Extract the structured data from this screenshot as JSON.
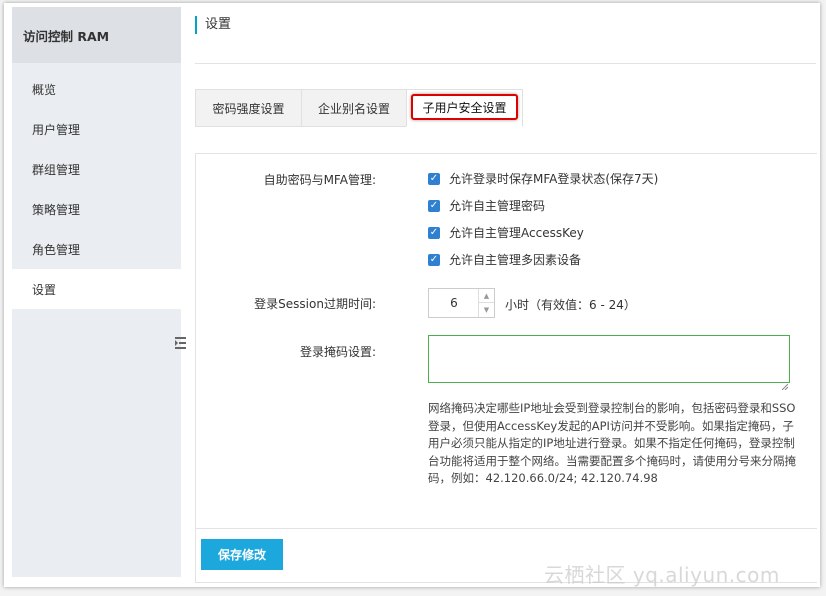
{
  "sidebar": {
    "title": "访问控制 RAM",
    "items": [
      {
        "label": "概览"
      },
      {
        "label": "用户管理"
      },
      {
        "label": "群组管理"
      },
      {
        "label": "策略管理"
      },
      {
        "label": "角色管理"
      },
      {
        "label": "设置",
        "active": true
      }
    ]
  },
  "header": {
    "title": "设置"
  },
  "tabs": [
    {
      "label": "密码强度设置"
    },
    {
      "label": "企业别名设置"
    },
    {
      "label": "子用户安全设置",
      "active": true
    }
  ],
  "form": {
    "mfa_label": "自助密码与MFA管理:",
    "options": [
      {
        "label": "允许登录时保存MFA登录状态(保存7天)",
        "checked": true
      },
      {
        "label": "允许自主管理密码",
        "checked": true
      },
      {
        "label": "允许自主管理AccessKey",
        "checked": true
      },
      {
        "label": "允许自主管理多因素设备",
        "checked": true
      }
    ],
    "session_label": "登录Session过期时间:",
    "session_value": "6",
    "session_unit": "小时（有效值：6 - 24）",
    "mask_label": "登录掩码设置:",
    "mask_value": "",
    "mask_help": "网络掩码决定哪些IP地址会受到登录控制台的影响，包括密码登录和SSO登录，但使用AccessKey发起的API访问并不受影响。如果指定掩码，子用户必须只能从指定的IP地址进行登录。如果不指定任何掩码，登录控制台功能将适用于整个网络。当需要配置多个掩码时，请使用分号来分隔掩码，例如：42.120.66.0/24; 42.120.74.98"
  },
  "footer": {
    "save_label": "保存修改"
  },
  "watermark": "云栖社区 yq.aliyun.com",
  "colors": {
    "accent": "#1ca8dd",
    "highlight": "#e00000",
    "checkbox": "#2f80d1"
  }
}
